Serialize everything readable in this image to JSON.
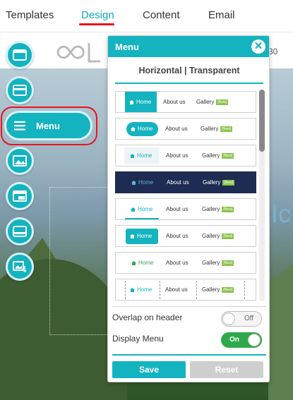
{
  "tabs": [
    {
      "label": "Templates"
    },
    {
      "label": "Design"
    },
    {
      "label": "Content"
    },
    {
      "label": "Email"
    }
  ],
  "header": {
    "number": "30"
  },
  "hero": {
    "text": "Ic"
  },
  "toolbar": {
    "menu_label": "Menu"
  },
  "panel": {
    "title": "Menu",
    "close": "✕",
    "subheading": "Horizontal | Transparent",
    "options": [
      {
        "home": "Home",
        "about": "About us",
        "gallery": "Gallery",
        "badge": "[New]"
      },
      {
        "home": "Home",
        "about": "About us",
        "gallery": "Gallery",
        "badge": "[New]"
      },
      {
        "home": "Home",
        "about": "About us",
        "gallery": "Gallery",
        "badge": "[New]"
      },
      {
        "home": "Home",
        "about": "About us",
        "gallery": "Gallery",
        "badge": "[New]"
      },
      {
        "home": "Home",
        "about": "About us",
        "gallery": "Gallery",
        "badge": "[New]"
      },
      {
        "home": "Home",
        "about": "About us",
        "gallery": "Gallery",
        "badge": "[New]"
      },
      {
        "home": "Home",
        "about": "About us",
        "gallery": "Gallery",
        "badge": "[New]"
      },
      {
        "home": "Home",
        "about": "About us",
        "gallery": "Gallery",
        "badge": "[New]"
      }
    ],
    "overlap_label": "Overlap on header",
    "overlap_state": "Off",
    "display_label": "Display Menu",
    "display_state": "On",
    "save_label": "Save",
    "reset_label": "Reset"
  },
  "colors": {
    "accent": "#14b3c0",
    "highlight": "#e8141e",
    "on": "#2ea84a",
    "new_badge": "#8bc34a"
  }
}
